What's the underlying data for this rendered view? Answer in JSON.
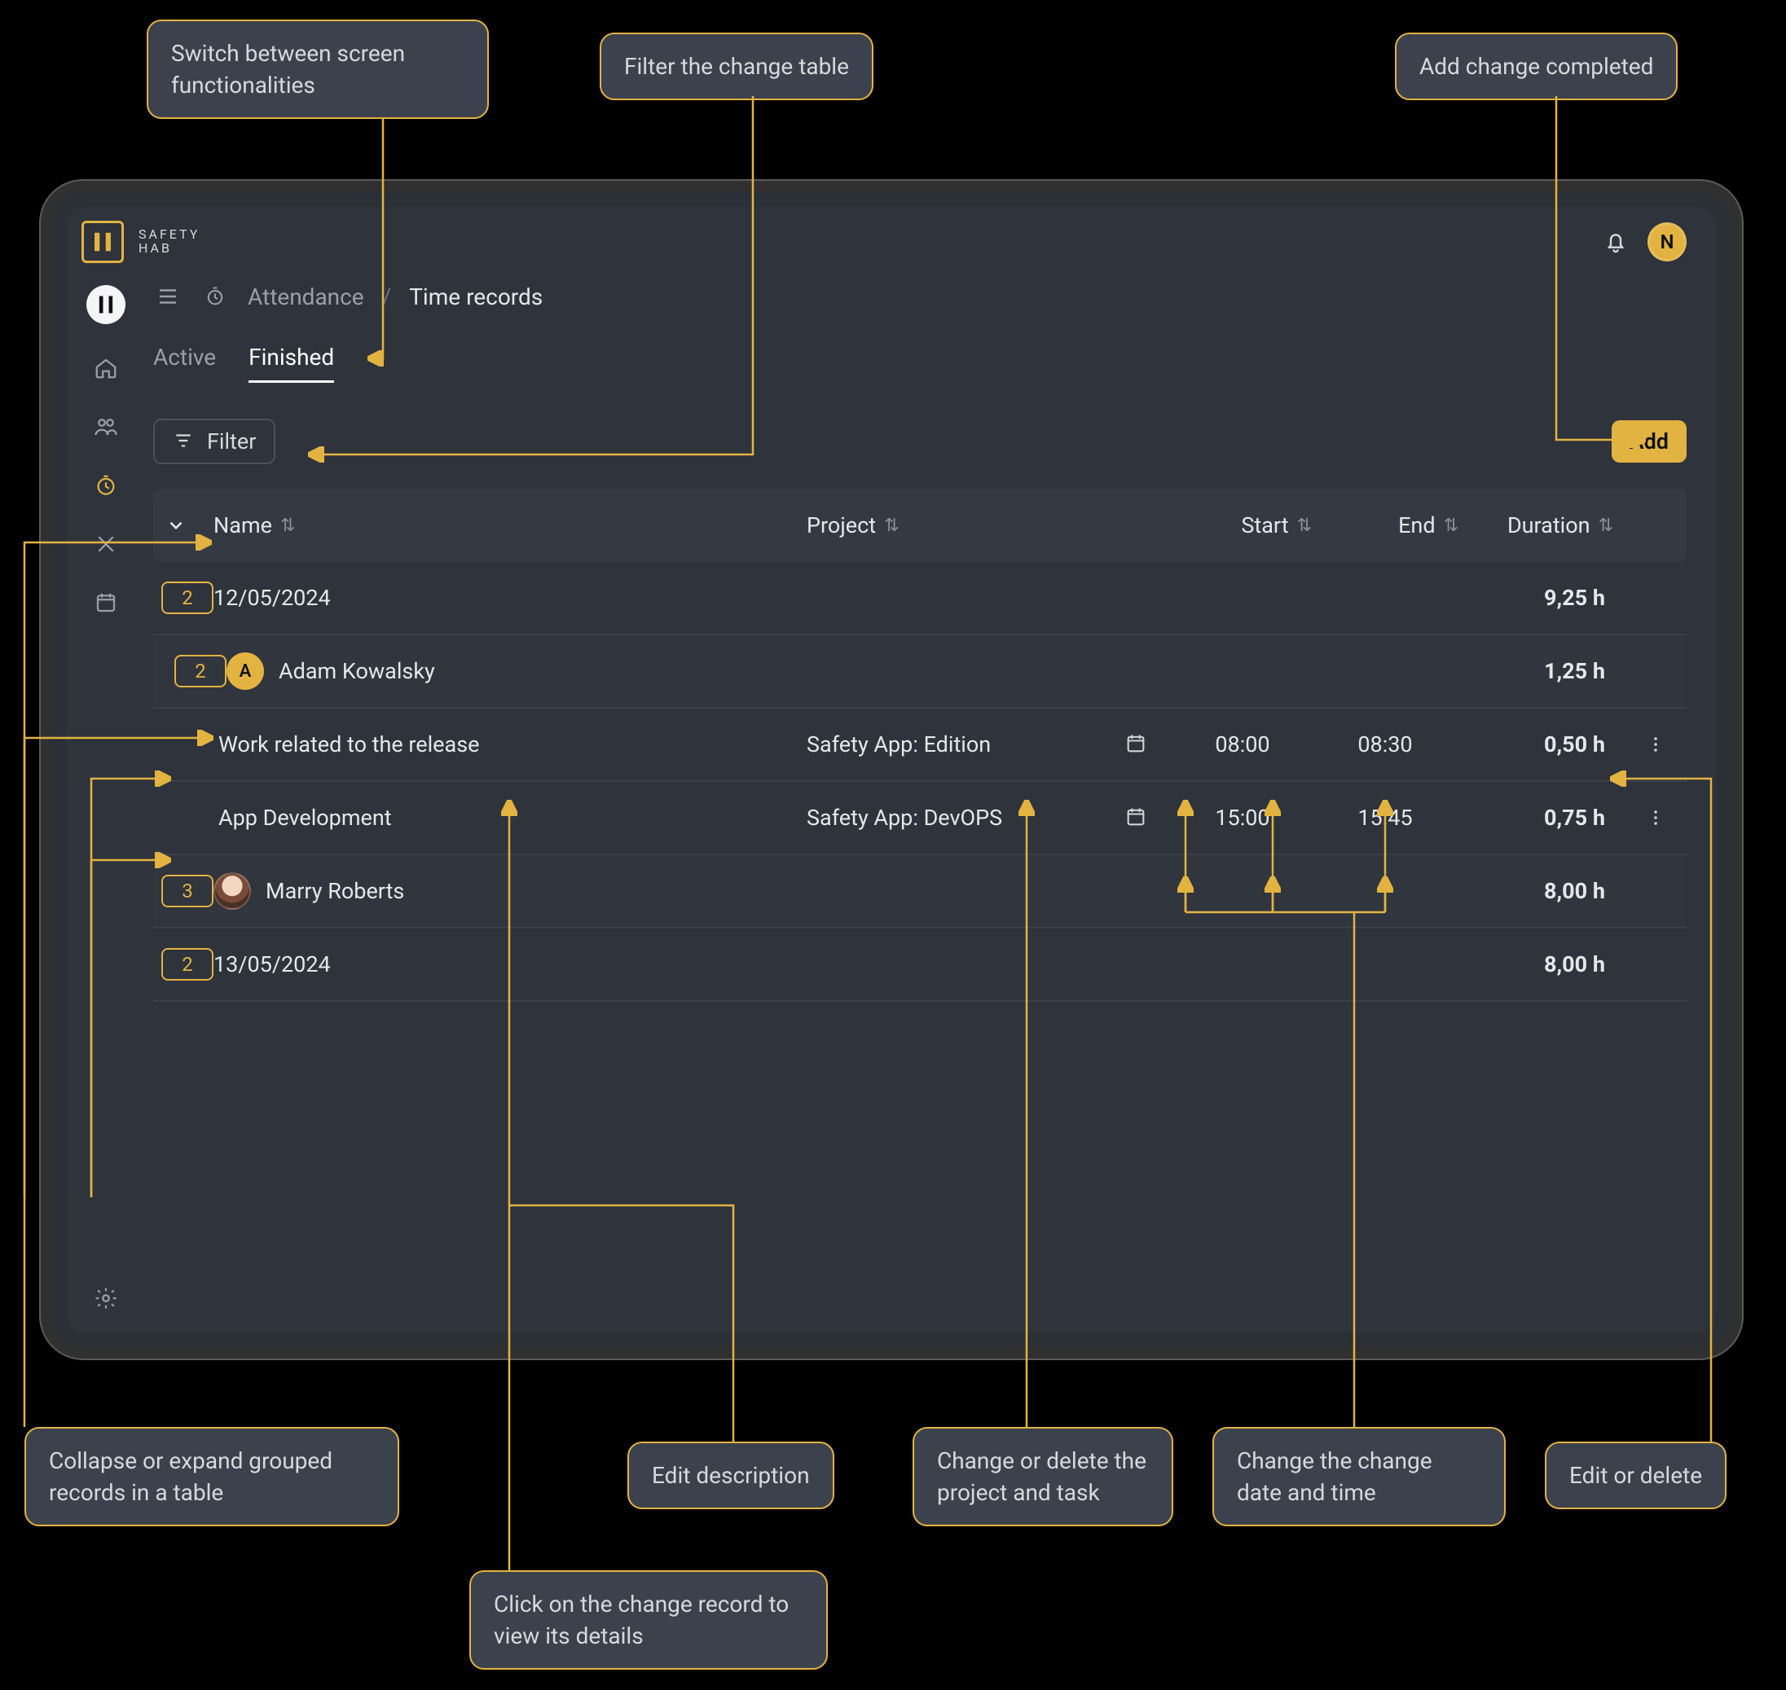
{
  "annotations": {
    "switch": "Switch between screen functionalities",
    "filter": "Filter the change table",
    "addChange": "Add change completed",
    "collapse": "Collapse or expand grouped records in a table",
    "editDesc": "Edit description",
    "changeProject": "Change or delete the project and task",
    "changeDateTime": "Change the change date and time",
    "editDelete": "Edit or delete",
    "clickRecord": "Click on the change record to view its details"
  },
  "brand": {
    "name": "SAFETY",
    "sub": "HAB",
    "badge": "N"
  },
  "breadcrumb": {
    "section": "Attendance",
    "page": "Time records",
    "slash": "/"
  },
  "tabs": {
    "active": "Active",
    "finished": "Finished"
  },
  "actions": {
    "filter": "Filter",
    "add": "Add"
  },
  "columns": {
    "name": "Name",
    "project": "Project",
    "start": "Start",
    "end": "End",
    "duration": "Duration"
  },
  "rows": {
    "date1": {
      "count": "2",
      "date": "12/05/2024",
      "duration": "9,25 h"
    },
    "user1": {
      "count": "2",
      "initial": "A",
      "name": "Adam Kowalsky",
      "duration": "1,25 h"
    },
    "d1": {
      "desc": "Work related to the release",
      "project": "Safety App: Edition",
      "start": "08:00",
      "end": "08:30",
      "duration": "0,50 h"
    },
    "d2": {
      "desc": "App Development",
      "project": "Safety App: DevOPS",
      "start": "15:00",
      "end": "15:45",
      "duration": "0,75 h"
    },
    "user2": {
      "count": "3",
      "name": "Marry Roberts",
      "duration": "8,00 h"
    },
    "date2": {
      "count": "2",
      "date": "13/05/2024",
      "duration": "8,00 h"
    }
  }
}
